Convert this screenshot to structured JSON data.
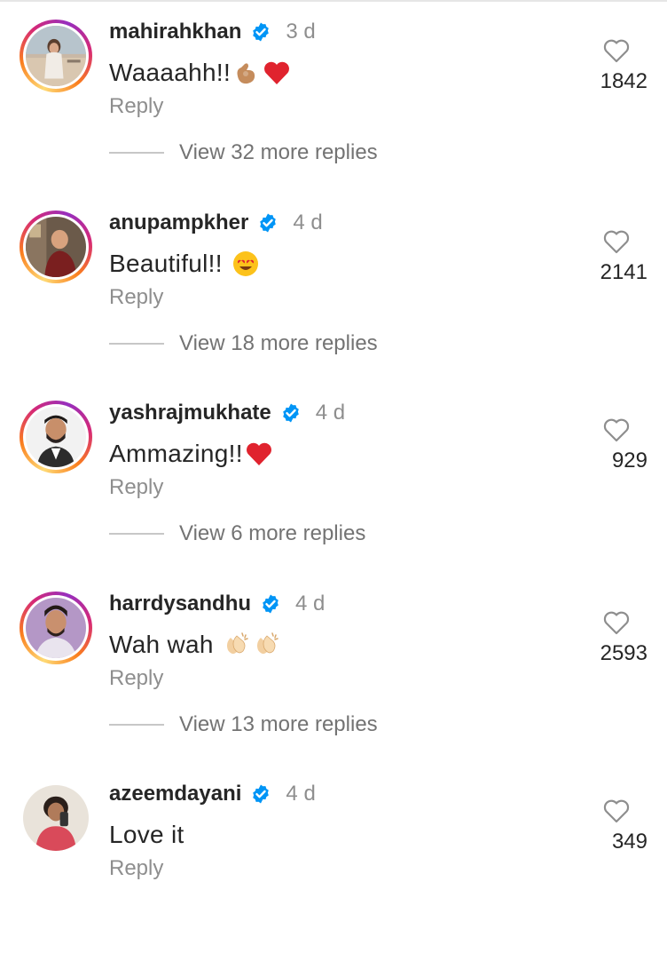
{
  "comments": [
    {
      "username": "mahirahkhan",
      "time": "3 d",
      "text": "Waaaahh!!",
      "emojis": [
        "pinch-hand-emoji",
        "red-heart-emoji"
      ],
      "reply_label": "Reply",
      "likes": "1842",
      "view_replies": "View 32 more replies",
      "story_ring": true
    },
    {
      "username": "anupampkher",
      "time": "4 d",
      "text": "Beautiful!!",
      "emojis": [
        "heart-eyes-emoji"
      ],
      "reply_label": "Reply",
      "likes": "2141",
      "view_replies": "View 18 more replies",
      "story_ring": true
    },
    {
      "username": "yashrajmukhate",
      "time": "4 d",
      "text": "Ammazing!!",
      "emojis": [
        "red-heart-emoji"
      ],
      "reply_label": "Reply",
      "likes": "929",
      "view_replies": "View 6 more replies",
      "story_ring": true
    },
    {
      "username": "harrdysandhu",
      "time": "4 d",
      "text": "Wah wah",
      "emojis": [
        "clapping-hands-emoji",
        "clapping-hands-emoji"
      ],
      "reply_label": "Reply",
      "likes": "2593",
      "view_replies": "View 13 more replies",
      "story_ring": true
    },
    {
      "username": "azeemdayani",
      "time": "4 d",
      "text": "Love it",
      "emojis": [],
      "reply_label": "Reply",
      "likes": "349",
      "story_ring": false
    }
  ],
  "icons": {
    "verified": "verified-badge-icon",
    "like": "heart-outline-icon"
  },
  "colors": {
    "verified_blue": "#0095f6",
    "secondary_text": "#8e8e8e",
    "primary_text": "#262626"
  }
}
